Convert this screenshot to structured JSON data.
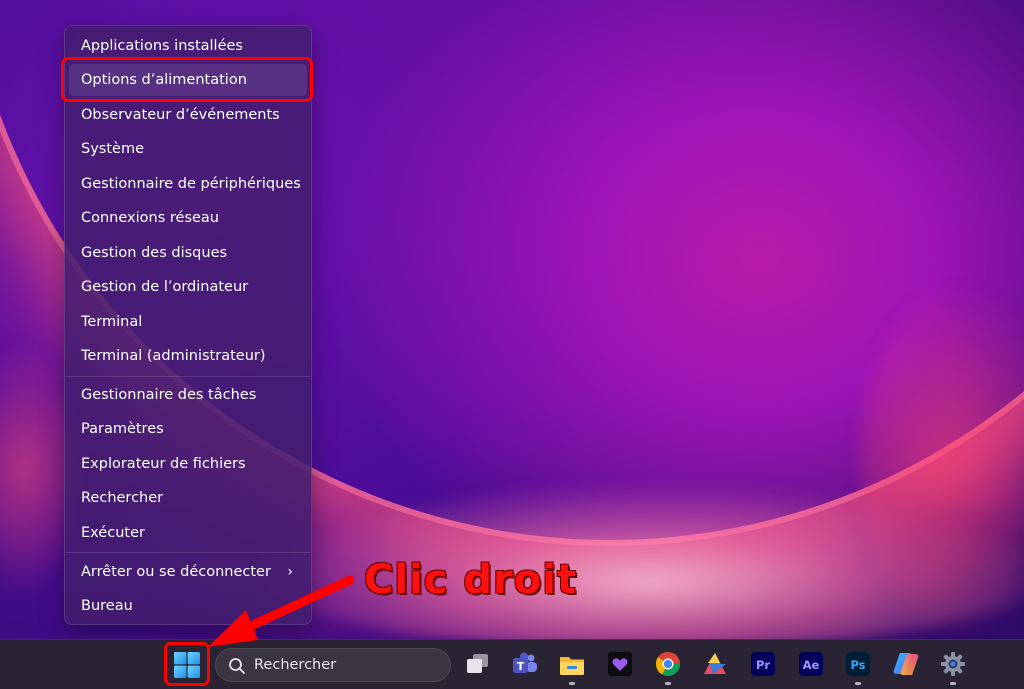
{
  "context_menu": {
    "items": [
      {
        "label": "Applications installées"
      },
      {
        "label": "Options d’alimentation"
      },
      {
        "label": "Observateur d’événements"
      },
      {
        "label": "Système"
      },
      {
        "label": "Gestionnaire de périphériques"
      },
      {
        "label": "Connexions réseau"
      },
      {
        "label": "Gestion des disques"
      },
      {
        "label": "Gestion de l’ordinateur"
      },
      {
        "label": "Terminal"
      },
      {
        "label": "Terminal (administrateur)"
      },
      {
        "label": "Gestionnaire des tâches"
      },
      {
        "label": "Paramètres"
      },
      {
        "label": "Explorateur de fichiers"
      },
      {
        "label": "Rechercher"
      },
      {
        "label": "Exécuter"
      },
      {
        "label": "Arrêter ou se déconnecter",
        "submenu_glyph": "›"
      },
      {
        "label": "Bureau"
      }
    ],
    "highlighted_item": "Options d’alimentation"
  },
  "annotation": {
    "text": "Clic droit",
    "color": "#ff1010"
  },
  "taskbar": {
    "start_icon": "windows-logo-icon",
    "search": {
      "label": "Rechercher",
      "icon": "search-icon"
    },
    "apps": [
      {
        "name": "task-view-icon",
        "running": false
      },
      {
        "name": "teams-icon",
        "running": false
      },
      {
        "name": "file-explorer-icon",
        "running": true
      },
      {
        "name": "heart-app-icon",
        "running": false
      },
      {
        "name": "chrome-icon",
        "running": true
      },
      {
        "name": "affinity-icon",
        "running": false
      },
      {
        "name": "premiere-pro-icon",
        "label": "Pr",
        "running": false
      },
      {
        "name": "after-effects-icon",
        "label": "Ae",
        "running": false
      },
      {
        "name": "photoshop-icon",
        "label": "Ps",
        "running": true
      },
      {
        "name": "copilot-icon",
        "running": false
      },
      {
        "name": "settings-gear-icon",
        "running": true
      }
    ]
  },
  "colors": {
    "menu_bg": "#421e6e",
    "taskbar_bg": "#2a2333",
    "highlight": "#ff0000"
  }
}
